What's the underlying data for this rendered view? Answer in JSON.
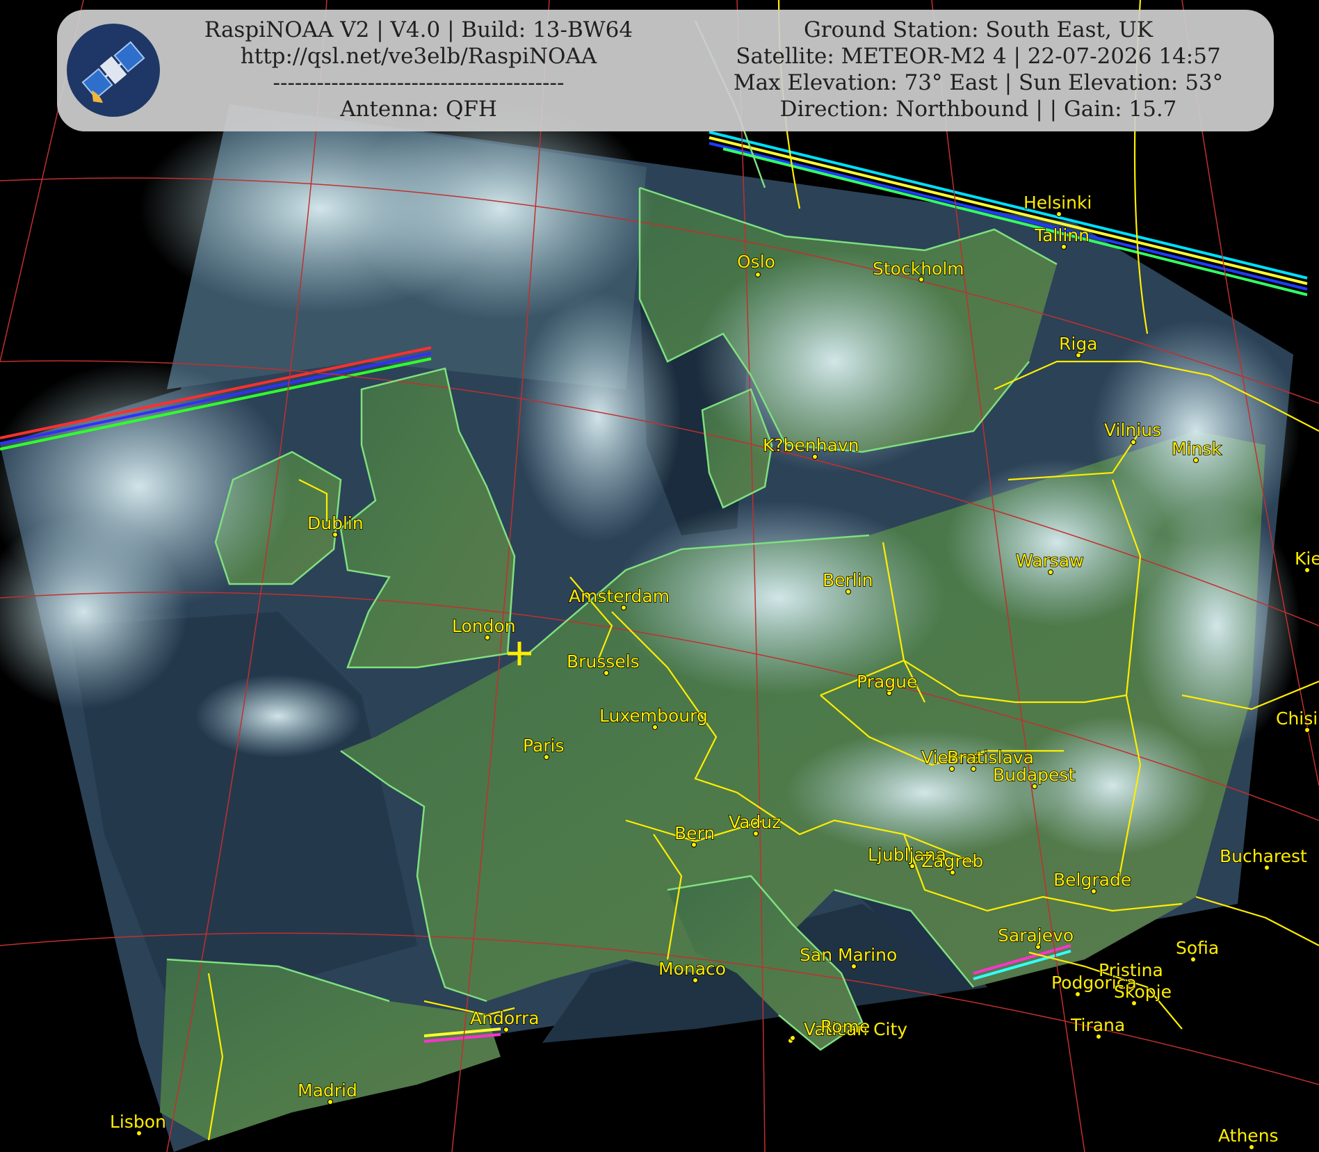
{
  "header": {
    "left_lines": [
      "RaspiNOAA V2 | V4.0 | Build: 13-BW64",
      "http://qsl.net/ve3elb/RaspiNOAA",
      "----------------------------------------",
      "Antenna: QFH"
    ],
    "right_lines": [
      "Ground Station: South East, UK",
      "Satellite: METEOR-M2 4 | 22-07-2026 14:57",
      "Max Elevation: 73° East | Sun Elevation: 53°",
      "Direction: Northbound | | Gain: 15.7"
    ],
    "logo_icon": "satellite-icon"
  },
  "colors": {
    "city_label": "#ffee00",
    "coastline": "#7fe07f",
    "border": "#ffee00",
    "graticule": "#c0302f",
    "ground_station_marker": "#ffee00",
    "background": "#000000"
  },
  "ground_station_marker": {
    "icon": "plus-icon"
  },
  "cities": [
    {
      "name": "Oslo"
    },
    {
      "name": "Stockholm"
    },
    {
      "name": "Helsinki"
    },
    {
      "name": "Tallinn"
    },
    {
      "name": "Riga"
    },
    {
      "name": "Vilnius"
    },
    {
      "name": "Minsk"
    },
    {
      "name": "K?benhavn"
    },
    {
      "name": "Dublin"
    },
    {
      "name": "London"
    },
    {
      "name": "Amsterdam"
    },
    {
      "name": "Brussels"
    },
    {
      "name": "Luxembourg"
    },
    {
      "name": "Paris"
    },
    {
      "name": "Berlin"
    },
    {
      "name": "Warsaw"
    },
    {
      "name": "Prague"
    },
    {
      "name": "Vienna"
    },
    {
      "name": "Bratislava"
    },
    {
      "name": "Budapest"
    },
    {
      "name": "Vaduz"
    },
    {
      "name": "Bern"
    },
    {
      "name": "Ljubljana"
    },
    {
      "name": "Zagreb"
    },
    {
      "name": "Belgrade"
    },
    {
      "name": "Bucharest"
    },
    {
      "name": "Sarajevo"
    },
    {
      "name": "Sofia"
    },
    {
      "name": "Pristina"
    },
    {
      "name": "Podgorica"
    },
    {
      "name": "Skopje"
    },
    {
      "name": "Tirana"
    },
    {
      "name": "Monaco"
    },
    {
      "name": "San Marino"
    },
    {
      "name": "Vatican City"
    },
    {
      "name": "Rome"
    },
    {
      "name": "Andorra"
    },
    {
      "name": "Madrid"
    },
    {
      "name": "Lisbon"
    },
    {
      "name": "Athens"
    },
    {
      "name": "Kiev"
    },
    {
      "name": "Chisinau"
    }
  ]
}
